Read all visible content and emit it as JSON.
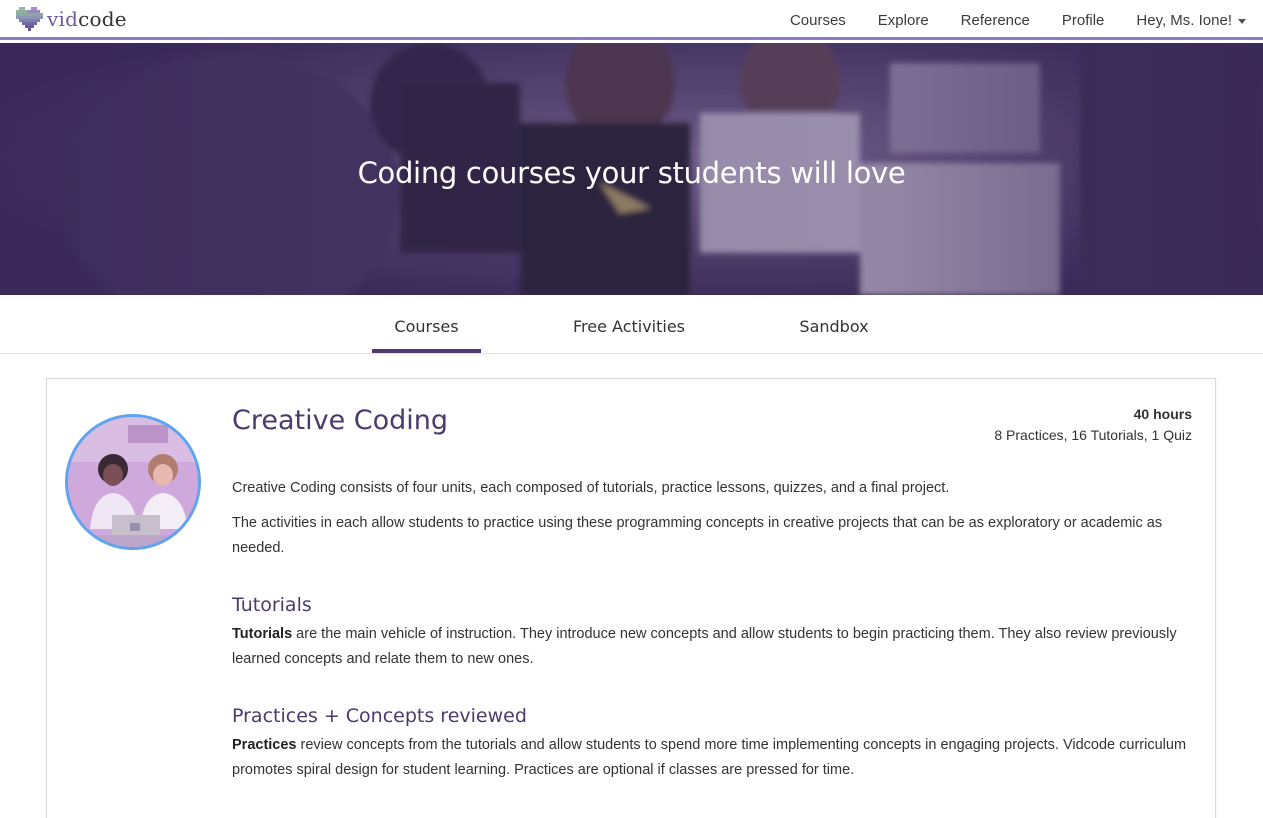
{
  "brand": {
    "name_part1": "vid",
    "name_part2": "code",
    "logo_icon": "pixel-heart-icon",
    "accent": "#8d7bc7",
    "primary": "#4b3a6e"
  },
  "nav": {
    "links": [
      "Courses",
      "Explore",
      "Reference",
      "Profile"
    ],
    "user_label": "Hey, Ms. Ione!"
  },
  "hero": {
    "title": "Coding courses your students will love"
  },
  "tabs": [
    {
      "label": "Courses",
      "active": true
    },
    {
      "label": "Free Activities",
      "active": false
    },
    {
      "label": "Sandbox",
      "active": false
    }
  ],
  "course": {
    "title": "Creative Coding",
    "hours": "40 hours",
    "counts": "8 Practices, 16 Tutorials, 1 Quiz",
    "intro_1": "Creative Coding consists of four units, each composed of tutorials, practice lessons, quizzes, and a final project.",
    "intro_2": "The activities in each allow students to practice using these programming concepts in creative projects that can be as exploratory or academic as needed.",
    "sections": [
      {
        "heading": "Tutorials",
        "term": "Tutorials",
        "text": " are the main vehicle of instruction. They introduce new concepts and allow students to begin practicing them. They also review previously learned concepts and relate them to new ones."
      },
      {
        "heading": "Practices + Concepts reviewed",
        "term": "Practices",
        "text": " review concepts from the tutorials and allow students to spend more time implementing concepts in engaging projects. Vidcode curriculum promotes spiral design for student learning. Practices are optional if classes are pressed for time."
      }
    ]
  }
}
